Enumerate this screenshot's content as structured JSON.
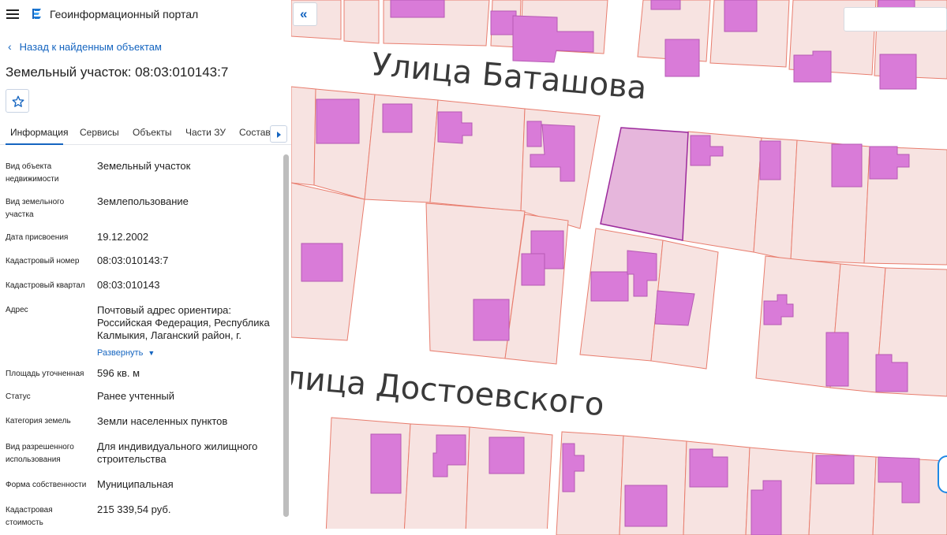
{
  "header": {
    "title": "Геоинформационный портал",
    "menu_icon": "hamburger-menu-icon",
    "logo_icon": "portal-logo-icon"
  },
  "navigation": {
    "back_label": "Назад к найденным объектам"
  },
  "object": {
    "title": "Земельный участок: 08:03:010143:7"
  },
  "tabs": [
    {
      "label": "Информация",
      "active": true
    },
    {
      "label": "Сервисы"
    },
    {
      "label": "Объекты"
    },
    {
      "label": "Части ЗУ"
    },
    {
      "label": "Состав"
    }
  ],
  "properties": [
    {
      "label": "Вид объекта недвижимости",
      "value": "Земельный участок"
    },
    {
      "label": "Вид земельного участка",
      "value": "Землепользование"
    },
    {
      "label": "Дата присвоения",
      "value": "19.12.2002"
    },
    {
      "label": "Кадастровый номер",
      "value": "08:03:010143:7"
    },
    {
      "label": "Кадастровый квартал",
      "value": "08:03:010143"
    },
    {
      "label": "Адрес",
      "value": "Почтовый адрес ориентира: Российская Федерация, Республика Калмыкия, Лаганский район, г."
    },
    {
      "label": "Площадь уточненная",
      "value": "596 кв. м"
    },
    {
      "label": "Статус",
      "value": "Ранее учтенный"
    },
    {
      "label": "Категория земель",
      "value": "Земли населенных пунктов"
    },
    {
      "label": "Вид разрешенного использования",
      "value": "Для индивидуального жилищного строительства"
    },
    {
      "label": "Форма собственности",
      "value": "Муниципальная"
    },
    {
      "label": "Кадастровая стоимость",
      "value": "215 339,54 руб."
    }
  ],
  "expand_label": "Развернуть",
  "map": {
    "street_top": "Улица Баташова",
    "street_bottom": "лица Достоевского",
    "colors": {
      "parcel_fill": "#f7e3e1",
      "parcel_stroke": "#e87d6e",
      "building_fill": "#d97bd8",
      "building_stroke": "#b65ab4",
      "selected_fill": "#e6b6dc",
      "selected_stroke": "#9c2a9c",
      "accent": "#1565c0"
    }
  }
}
